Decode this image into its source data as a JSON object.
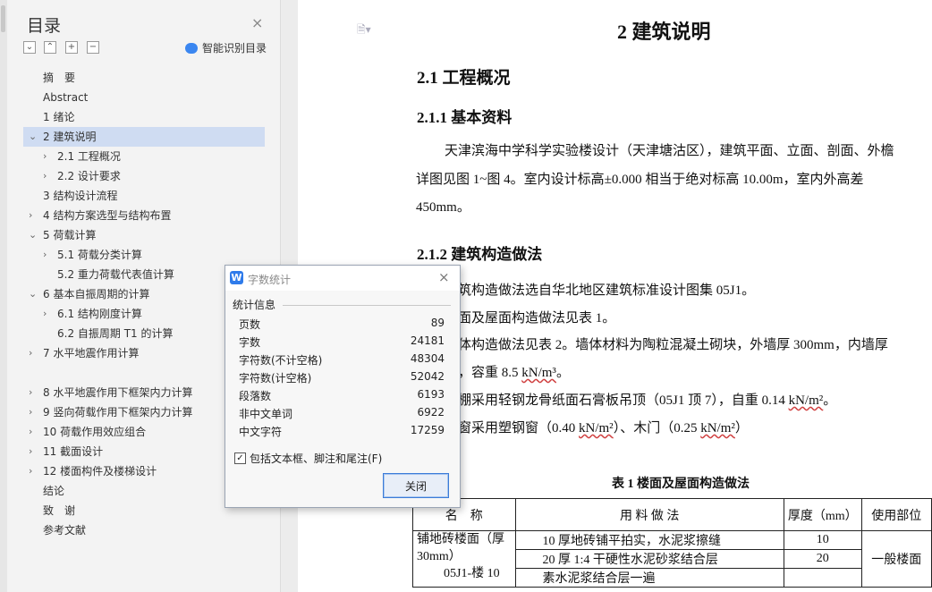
{
  "nav": {
    "title": "目录",
    "close_glyph": "×",
    "buttons": [
      "⌄",
      "⌃",
      "+",
      "−"
    ],
    "smart_toc_label": "智能识别目录",
    "items": [
      {
        "label": "摘　要",
        "level": 1,
        "chevron": ""
      },
      {
        "label": "Abstract",
        "level": 1,
        "chevron": ""
      },
      {
        "label": "1 绪论",
        "level": 1,
        "chevron": ""
      },
      {
        "label": "2 建筑说明",
        "level": 1,
        "chevron": "⌄",
        "selected": true
      },
      {
        "label": "2.1 工程概况",
        "level": 2,
        "chevron": "›"
      },
      {
        "label": "2.2 设计要求",
        "level": 2,
        "chevron": "›"
      },
      {
        "label": "3 结构设计流程",
        "level": 1,
        "chevron": ""
      },
      {
        "label": "4 结构方案选型与结构布置",
        "level": 1,
        "chevron": "›"
      },
      {
        "label": "5 荷载计算",
        "level": 1,
        "chevron": "⌄"
      },
      {
        "label": "5.1 荷载分类计算",
        "level": 2,
        "chevron": "›"
      },
      {
        "label": "5.2 重力荷载代表值计算",
        "level": 2,
        "chevron": ""
      },
      {
        "label": "6 基本自振周期的计算",
        "level": 1,
        "chevron": "⌄"
      },
      {
        "label": "6.1  结构刚度计算",
        "level": 2,
        "chevron": "›"
      },
      {
        "label": "6.2 自振周期 T1 的计算",
        "level": 2,
        "chevron": ""
      },
      {
        "label": "7 水平地震作用计算",
        "level": 1,
        "chevron": "›"
      },
      {
        "label": "",
        "level": 0,
        "chevron": "",
        "gap": true
      },
      {
        "label": "8 水平地震作用下框架内力计算",
        "level": 1,
        "chevron": "›"
      },
      {
        "label": "9 竖向荷载作用下框架内力计算",
        "level": 1,
        "chevron": "›"
      },
      {
        "label": "10 荷载作用效应组合",
        "level": 1,
        "chevron": "›"
      },
      {
        "label": "11 截面设计",
        "level": 1,
        "chevron": "›"
      },
      {
        "label": "12 楼面构件及楼梯设计",
        "level": 1,
        "chevron": "›"
      },
      {
        "label": "结论",
        "level": 1,
        "chevron": ""
      },
      {
        "label": "致　谢",
        "level": 1,
        "chevron": ""
      },
      {
        "label": "参考文献",
        "level": 1,
        "chevron": ""
      }
    ]
  },
  "document": {
    "chapter_title": "2 建筑说明",
    "section_title": "2.1 工程概况",
    "subsection_1": "2.1.1 基本资料",
    "para_1_line_1": "天津滨海中学科学实验楼设计（天津塘沽区），建筑平面、立面、剖面、外檐",
    "para_1_line_2": "详图见图 1~图 4。室内设计标高±0.000 相当于绝对标高 10.00m，室内外高差",
    "para_1_line_3": "450mm。",
    "subsection_2": "2.1.2 建筑构造做法",
    "line_a": "筑构造做法选自华北地区建筑标准设计图集 05J1。",
    "line_b": "面及屋面构造做法见表 1。",
    "line_c": "体构造做法见表 2。墙体材料为陶粒混凝土砌块，外墙厚 300mm，内墙厚",
    "line_d_pre": "，容重 8.5 ",
    "line_d_unit": "kN/m³",
    "line_d_post": "。",
    "line_e_pre": "棚采用轻钢龙骨纸面石膏板吊顶（05J1 顶 7），自重 0.14 ",
    "line_e_unit": "kN/m²",
    "line_e_post": "。",
    "line_f_pre": "窗采用塑钢窗（0.40 ",
    "line_f_unit1": "kN/m²",
    "line_f_mid": "）、木门（0.25 ",
    "line_f_unit2": "kN/m²",
    "line_f_post": "）",
    "table_caption": "表 1  楼面及屋面构造做法",
    "table": {
      "headers": [
        "名　称",
        "用 料 做 法",
        "厚度（mm）",
        "使用部位"
      ],
      "row_name_1": "铺地砖楼面（厚",
      "row_name_2": "30mm）",
      "row_name_3": "05J1-楼 10",
      "materials": [
        "10 厚地砖铺平拍实，水泥浆擦缝",
        "20 厚 1:4 干硬性水泥砂浆结合层",
        "素水泥浆结合层一遍"
      ],
      "thickness": [
        "10",
        "20",
        ""
      ],
      "usage": "一般楼面"
    }
  },
  "dialog": {
    "title": "字数统计",
    "logo_glyph": "W",
    "close_glyph": "×",
    "section_label": "统计信息",
    "stats": [
      {
        "label": "页数",
        "value": "89"
      },
      {
        "label": "字数",
        "value": "24181"
      },
      {
        "label": "字符数(不计空格)",
        "value": "48304"
      },
      {
        "label": "字符数(计空格)",
        "value": "52042"
      },
      {
        "label": "段落数",
        "value": "6193"
      },
      {
        "label": "非中文单词",
        "value": "6922"
      },
      {
        "label": "中文字符",
        "value": "17259"
      }
    ],
    "checkbox_checked": true,
    "checkbox_glyph": "✓",
    "checkbox_label": "包括文本框、脚注和尾注(F)",
    "close_button": "关闭"
  },
  "colors": {
    "selection": "#cfdcf2",
    "accent": "#2f7bea"
  }
}
